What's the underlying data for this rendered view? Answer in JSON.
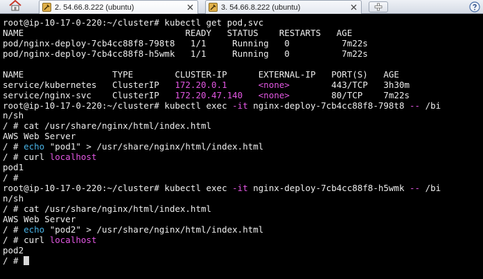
{
  "tabs": [
    {
      "label": "2. 54.66.8.222 (ubuntu)",
      "active": true
    },
    {
      "label": "3. 54.66.8.222 (ubuntu)",
      "active": false
    }
  ],
  "icons": {
    "home": "home-icon",
    "tab": "terminal-session-icon",
    "close": "close-icon",
    "new_tab": "new-tab-icon",
    "help": "help-icon"
  },
  "colors": {
    "background": "#000000",
    "text": "#ededed",
    "highlight_magenta": "#e257e2",
    "highlight_cyan": "#49b3e6",
    "tab_icon": "#e0b04a"
  },
  "terminal": {
    "lines": [
      [
        {
          "t": "root@ip-10-17-0-220:~/cluster# kubectl get pod,svc"
        }
      ],
      [
        {
          "t": "NAME                               READY   STATUS    RESTARTS   AGE"
        }
      ],
      [
        {
          "t": "pod/nginx-deploy-7cb4cc88f8-798t8   1/1     Running   0          7m22s"
        }
      ],
      [
        {
          "t": "pod/nginx-deploy-7cb4cc88f8-h5wmk   1/1     Running   0          7m22s"
        }
      ],
      [
        {
          "t": ""
        }
      ],
      [
        {
          "t": "NAME                 TYPE        CLUSTER-IP      EXTERNAL-IP   PORT(S)   AGE"
        }
      ],
      [
        {
          "t": "service/kubernetes   ClusterIP   "
        },
        {
          "t": "172.20.0.1",
          "c": "magenta"
        },
        {
          "t": "      "
        },
        {
          "t": "<none>",
          "c": "magenta"
        },
        {
          "t": "        443/TCP   3h30m"
        }
      ],
      [
        {
          "t": "service/nginx-svc    ClusterIP   "
        },
        {
          "t": "172.20.47.140",
          "c": "magenta"
        },
        {
          "t": "   "
        },
        {
          "t": "<none>",
          "c": "magenta"
        },
        {
          "t": "        80/TCP    7m22s"
        }
      ],
      [
        {
          "t": "root@ip-10-17-0-220:~/cluster# kubectl exec "
        },
        {
          "t": "-it",
          "c": "magenta"
        },
        {
          "t": " nginx-deploy-7cb4cc88f8-798t8 "
        },
        {
          "t": "--",
          "c": "magenta"
        },
        {
          "t": " /bi"
        }
      ],
      [
        {
          "t": "n/sh"
        }
      ],
      [
        {
          "t": "/ # cat /usr/share/nginx/html/index.html"
        }
      ],
      [
        {
          "t": "AWS Web Server"
        }
      ],
      [
        {
          "t": "/ # "
        },
        {
          "t": "echo",
          "c": "cyan"
        },
        {
          "t": " \"pod1\" > /usr/share/nginx/html/index.html"
        }
      ],
      [
        {
          "t": "/ # curl "
        },
        {
          "t": "localhost",
          "c": "magenta"
        }
      ],
      [
        {
          "t": "pod1"
        }
      ],
      [
        {
          "t": "/ #"
        }
      ],
      [
        {
          "t": "root@ip-10-17-0-220:~/cluster# kubectl exec "
        },
        {
          "t": "-it",
          "c": "magenta"
        },
        {
          "t": " nginx-deploy-7cb4cc88f8-h5wmk "
        },
        {
          "t": "--",
          "c": "magenta"
        },
        {
          "t": " /bi"
        }
      ],
      [
        {
          "t": "n/sh"
        }
      ],
      [
        {
          "t": "/ # cat /usr/share/nginx/html/index.html"
        }
      ],
      [
        {
          "t": "AWS Web Server"
        }
      ],
      [
        {
          "t": "/ # "
        },
        {
          "t": "echo",
          "c": "cyan"
        },
        {
          "t": " \"pod2\" > /usr/share/nginx/html/index.html"
        }
      ],
      [
        {
          "t": "/ # curl "
        },
        {
          "t": "localhost",
          "c": "magenta"
        }
      ],
      [
        {
          "t": "pod2"
        }
      ],
      [
        {
          "t": "/ # "
        }
      ]
    ]
  }
}
